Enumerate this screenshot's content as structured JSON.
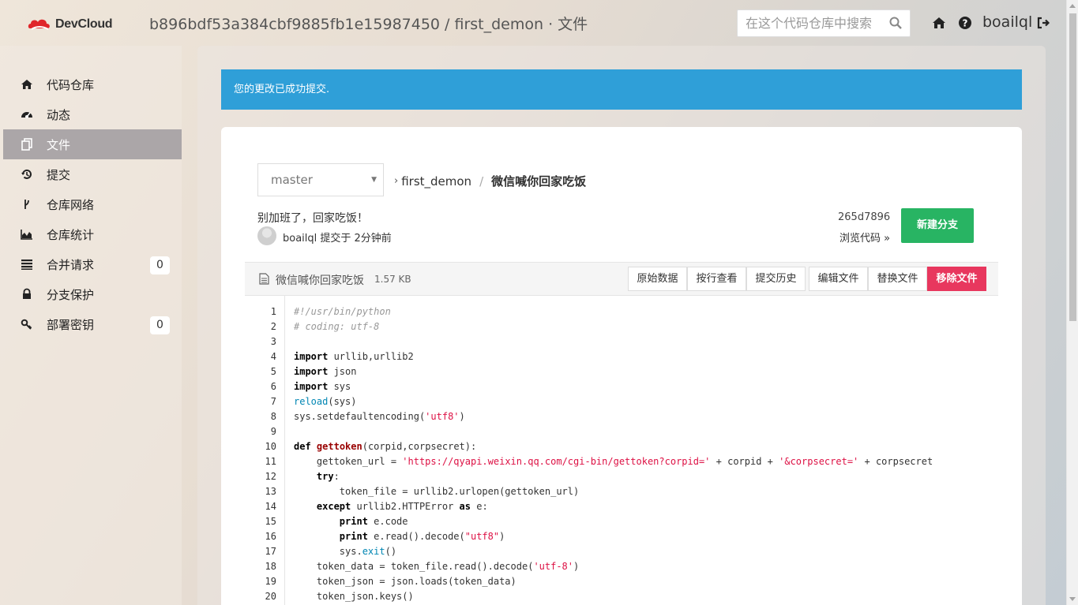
{
  "header": {
    "brand": "DevCloud",
    "title": "b896bdf53a384cbf9885fb1e15987450 / first_demon · 文件",
    "search_placeholder": "在这个代码仓库中搜索",
    "username": "boailql"
  },
  "sidebar": {
    "items": [
      {
        "label": "代码仓库",
        "icon": "home-icon"
      },
      {
        "label": "动态",
        "icon": "dashboard-icon"
      },
      {
        "label": "文件",
        "icon": "files-icon",
        "active": true
      },
      {
        "label": "提交",
        "icon": "history-icon"
      },
      {
        "label": "仓库网络",
        "icon": "branch-network-icon"
      },
      {
        "label": "仓库统计",
        "icon": "area-chart-icon"
      },
      {
        "label": "合并请求",
        "icon": "merge-list-icon",
        "badge": "0"
      },
      {
        "label": "分支保护",
        "icon": "lock-icon"
      },
      {
        "label": "部署密钥",
        "icon": "key-icon",
        "badge": "0"
      }
    ]
  },
  "alert": {
    "message": "您的更改已成功提交."
  },
  "repo": {
    "branch": "master",
    "breadcrumb_root": "first_demon",
    "breadcrumb_current": "微信喊你回家吃饭",
    "commit_message": "别加班了，回家吃饭！",
    "commit_author_line": "boailql 提交于 2分钟前",
    "commit_hash": "265d7896",
    "browse_code": "浏览代码 »",
    "new_branch_label": "新建分支"
  },
  "file": {
    "name": "微信喊你回家吃饭",
    "size": "1.57 KB",
    "actions": [
      "原始数据",
      "按行查看",
      "提交历史",
      "编辑文件",
      "替换文件",
      "移除文件"
    ]
  },
  "code": {
    "lines": [
      "#!/usr/bin/python",
      "# coding: utf-8",
      "",
      "import urllib,urllib2",
      "import json",
      "import sys",
      "reload(sys)",
      "sys.setdefaultencoding('utf8')",
      "",
      "def gettoken(corpid,corpsecret):",
      "    gettoken_url = 'https://qyapi.weixin.qq.com/cgi-bin/gettoken?corpid=' + corpid + '&corpsecret=' + corpsecret",
      "    try:",
      "        token_file = urllib2.urlopen(gettoken_url)",
      "    except urllib2.HTTPError as e:",
      "        print e.code",
      "        print e.read().decode(\"utf8\")",
      "        sys.exit()",
      "    token_data = token_file.read().decode('utf-8')",
      "    token_json = json.loads(token_data)",
      "    token_json.keys()"
    ]
  },
  "colors": {
    "alert_bg": "#2f9fd8",
    "success_button": "#28b463",
    "danger_button": "#e8375e",
    "sidebar_active": "#aba6a8"
  }
}
